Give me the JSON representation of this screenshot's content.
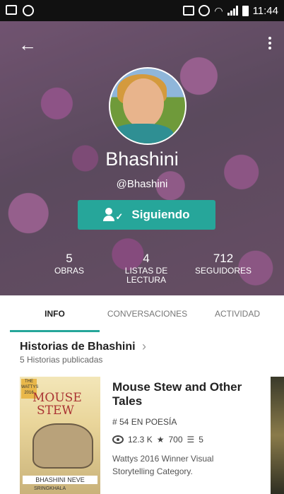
{
  "status_bar": {
    "time": "11:44",
    "left_icons": [
      "gallery-icon",
      "whatsapp-icon"
    ],
    "right_icons": [
      "nfc-icon",
      "alarm-icon",
      "wifi-icon",
      "signal-icon",
      "battery-icon"
    ]
  },
  "profile": {
    "name": "Bhashini",
    "handle": "@Bhashini",
    "follow_button": "Siguiendo",
    "stats": [
      {
        "value": "5",
        "label": "OBRAS"
      },
      {
        "value": "4",
        "label": "LISTAS DE LECTURA"
      },
      {
        "value": "712",
        "label": "SEGUIDORES"
      }
    ]
  },
  "tabs": [
    "INFO",
    "CONVERSACIONES",
    "ACTIVIDAD"
  ],
  "active_tab": "INFO",
  "stories_section": {
    "title": "Historias de Bhashini",
    "subtitle": "5 Historias publicadas",
    "book": {
      "title": "Mouse Stew and Other Tales",
      "rank": "# 54 EN POESÍA",
      "reads": "12.3 K",
      "votes": "700",
      "parts": "5",
      "description": "Wattys 2016 Winner Visual Storytelling Category.",
      "cover": {
        "title_line1": "MOUSE",
        "title_line2": "STEW",
        "badge": "THE WATTYS 2016",
        "author": "BHASHINI NEVE",
        "illustrator": "SRINGKHALA"
      }
    }
  },
  "colors": {
    "accent": "#26a69a",
    "status_bar": "#111111"
  }
}
